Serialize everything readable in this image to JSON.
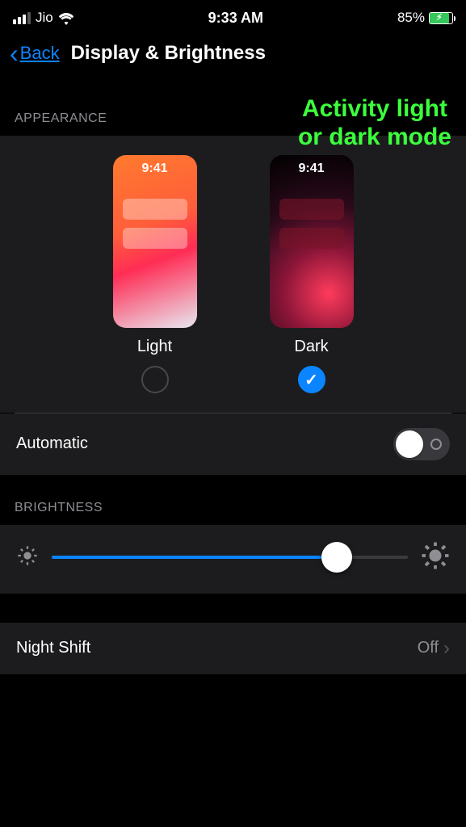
{
  "status": {
    "carrier": "Jio",
    "time": "9:33 AM",
    "battery_pct": "85%"
  },
  "nav": {
    "back_label": "Back",
    "title": "Display & Brightness"
  },
  "annotation": {
    "line1": "Activity light",
    "line2": "or dark mode"
  },
  "appearance": {
    "header": "APPEARANCE",
    "preview_time": "9:41",
    "light_label": "Light",
    "dark_label": "Dark",
    "selected": "dark"
  },
  "automatic": {
    "label": "Automatic",
    "enabled": false
  },
  "brightness": {
    "header": "BRIGHTNESS",
    "value_pct": 80
  },
  "night_shift": {
    "label": "Night Shift",
    "value": "Off"
  }
}
